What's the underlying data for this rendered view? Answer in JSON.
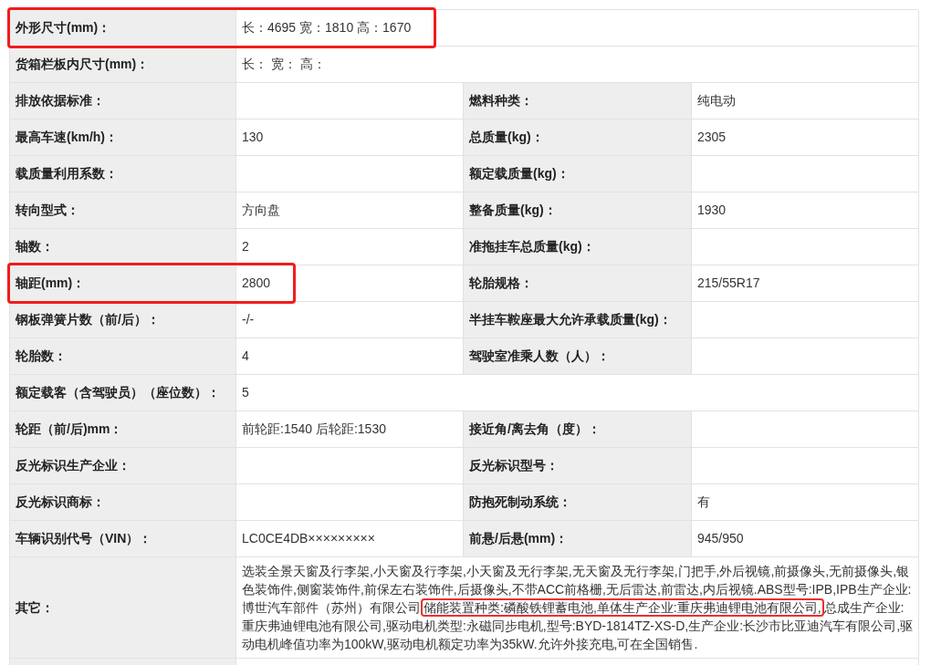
{
  "rows": [
    {
      "kind": "full",
      "label": "外形尺寸(mm)：",
      "value": "长：4695 宽：1810 高：1670",
      "highlighted": true
    },
    {
      "kind": "full",
      "label": "货箱栏板内尺寸(mm)：",
      "value": "长： 宽： 高："
    },
    {
      "kind": "pair",
      "label": "排放依据标准：",
      "label2": "燃料种类：",
      "value2": "纯电动"
    },
    {
      "kind": "pair",
      "label": "最高车速(km/h)：",
      "value": "130",
      "label2": "总质量(kg)：",
      "value2": "2305"
    },
    {
      "kind": "pair",
      "label": "载质量利用系数：",
      "label2": "额定载质量(kg)："
    },
    {
      "kind": "pair",
      "label": "转向型式：",
      "value": "方向盘",
      "label2": "整备质量(kg)：",
      "value2": "1930"
    },
    {
      "kind": "pair",
      "label": "轴数：",
      "value": "2",
      "label2": "准拖挂车总质量(kg)："
    },
    {
      "kind": "pair",
      "label": "轴距(mm)：",
      "value": "2800",
      "label2": "轮胎规格：",
      "value2": "215/55R17",
      "highlighted": true
    },
    {
      "kind": "pair",
      "label": "钢板弹簧片数（前/后）：",
      "value": "-/-",
      "label2": "半挂车鞍座最大允许承载质量(kg)："
    },
    {
      "kind": "pair",
      "label": "轮胎数：",
      "value": "4",
      "label2": "驾驶室准乘人数（人）："
    },
    {
      "kind": "full",
      "label": "额定载客（含驾驶员）（座位数）：",
      "value": "5"
    },
    {
      "kind": "pair",
      "label": "轮距（前/后)mm：",
      "value": "前轮距:1540 后轮距:1530",
      "label2": "接近角/离去角（度）："
    },
    {
      "kind": "pair",
      "label": "反光标识生产企业：",
      "label2": "反光标识型号："
    },
    {
      "kind": "pair",
      "label": "反光标识商标：",
      "label2": "防抱死制动系统：",
      "value2": "有"
    },
    {
      "kind": "pair",
      "label": "车辆识别代号（VIN）：",
      "value": "LC0CE4DB×××××××××",
      "label2": "前悬/后悬(mm)：",
      "value2": "945/950"
    },
    {
      "kind": "note",
      "label": "其它：",
      "segments": [
        {
          "text": "选装全景天窗及行李架,小天窗及行李架,小天窗及无行李架,无天窗及无行李架,门把手,外后视镜,前摄像头,无前摄像头,银色装饰件,侧窗装饰件,前保左右装饰件,后摄像头,不带ACC前格栅,无后雷达,前雷达,内后视镜.ABS型号:IPB,IPB生产企业:博世汽车部件（苏州）有限公司",
          "highlighted": false
        },
        {
          "text": "储能装置种类:磷酸铁锂蓄电池,单体生产企业:重庆弗迪锂电池有限公司,",
          "highlighted": true
        },
        {
          "text": "总成生产企业:重庆弗迪锂电池有限公司,驱动电机类型:永磁同步电机,型号:BYD-1814TZ-XS-D,生产企业:长沙市比亚迪汽车有限公司,驱动电机峰值功率为100kW,驱动电机额定功率为35kW.允许外接充电,可在全国销售.",
          "highlighted": false
        }
      ]
    }
  ]
}
